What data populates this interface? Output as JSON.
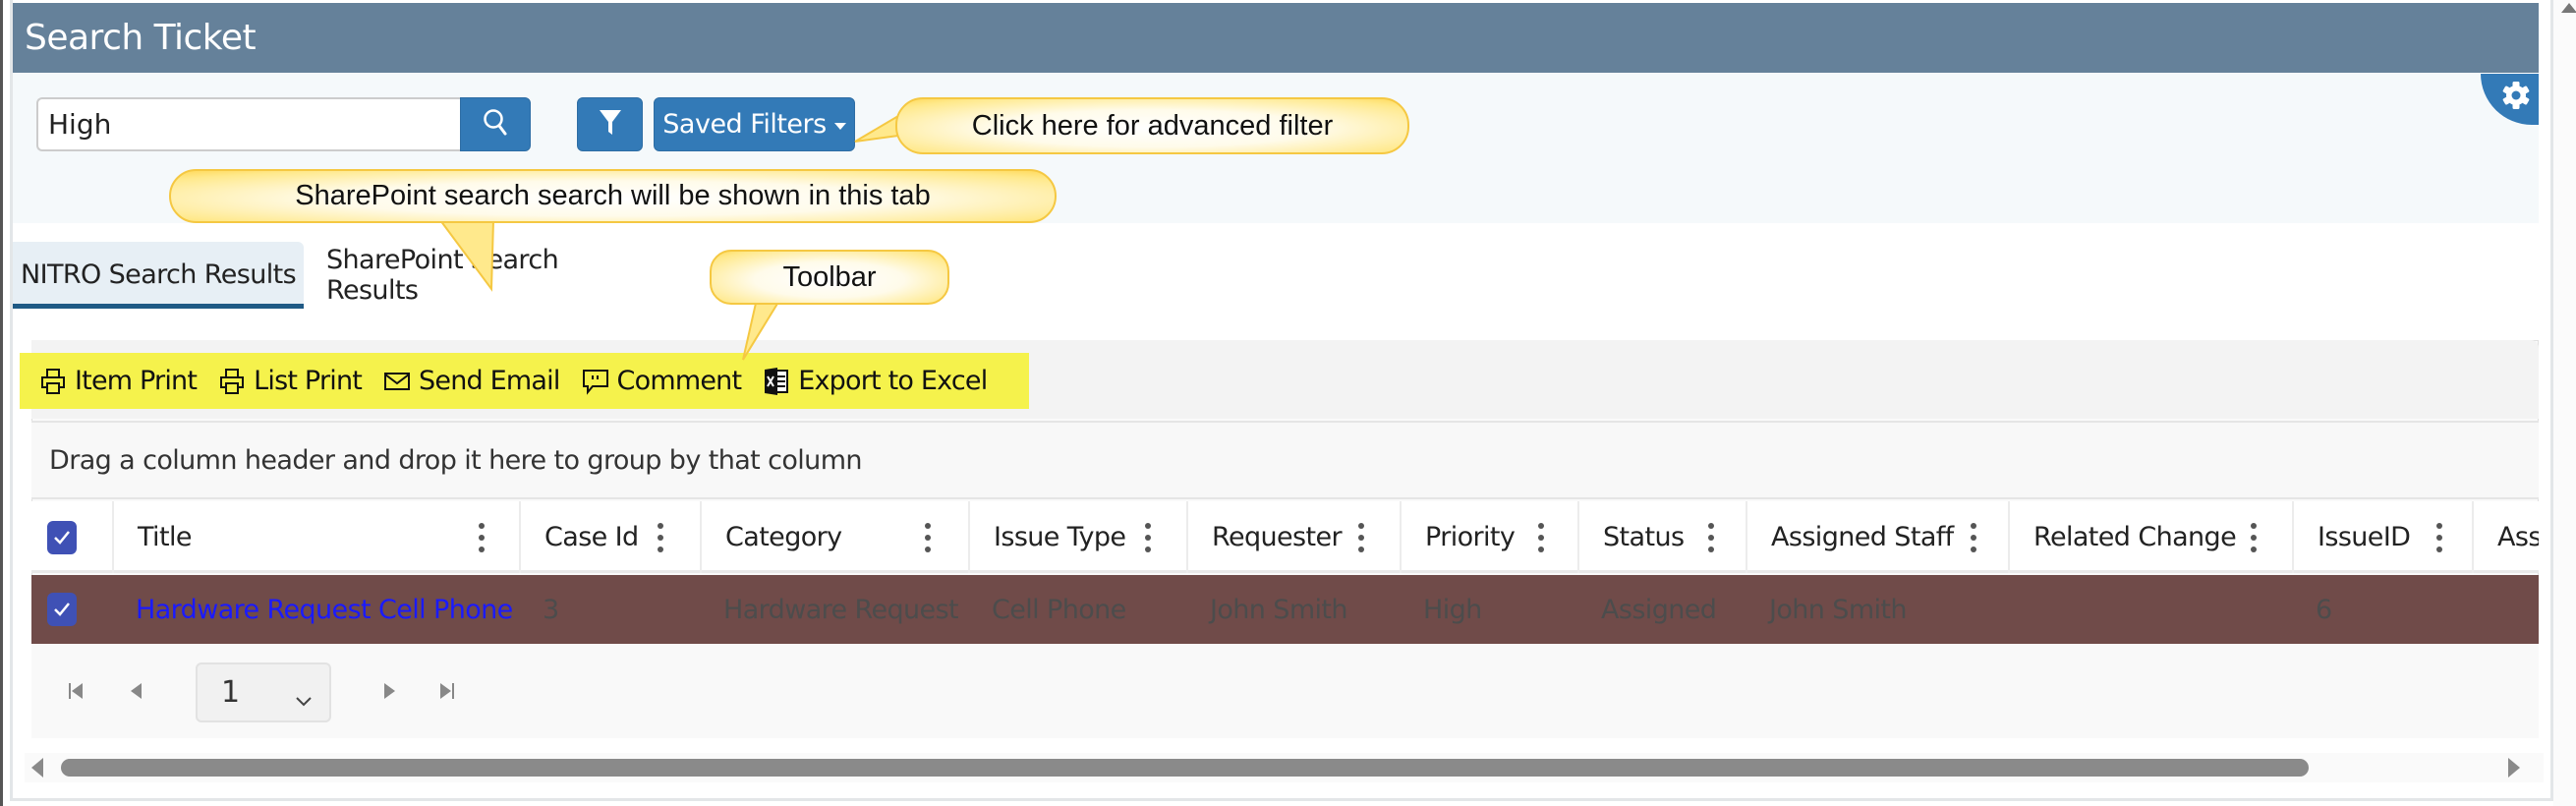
{
  "header": {
    "title": "Search Ticket"
  },
  "search": {
    "value": "High",
    "search_button": "search-icon",
    "filter_button": "filter-icon",
    "saved_filters_label": "Saved Filters",
    "settings_button": "gear-icon"
  },
  "callouts": {
    "advanced_filter": "Click here for advanced filter",
    "sharepoint_tab": "SharePoint search search will be shown in this tab",
    "toolbar": "Toolbar"
  },
  "tabs": [
    {
      "label": "NITRO Search Results",
      "active": true
    },
    {
      "label": "SharePoint Search Results",
      "active": false
    }
  ],
  "toolbar": {
    "items": [
      {
        "label": "Item Print",
        "icon": "printer-icon"
      },
      {
        "label": "List Print",
        "icon": "printer-icon"
      },
      {
        "label": "Send Email",
        "icon": "envelope-icon"
      },
      {
        "label": "Comment",
        "icon": "comment-icon"
      },
      {
        "label": "Export to Excel",
        "icon": "excel-icon"
      }
    ]
  },
  "grid": {
    "group_panel_text": "Drag a column header and drop it here to group by that column",
    "columns": [
      "Title",
      "Case Id",
      "Category",
      "Issue Type",
      "Requester",
      "Priority",
      "Status",
      "Assigned Staff",
      "Related Change",
      "IssueID",
      "Ass"
    ],
    "rows": [
      {
        "selected": true,
        "cells": [
          "Hardware Request Cell Phone",
          "3",
          "Hardware Request",
          "Cell Phone",
          "John Smith",
          "High",
          "Assigned",
          "John Smith",
          "",
          "6",
          ""
        ]
      }
    ],
    "colors": {
      "selected_row": "#704b49",
      "link": "#1a1aff",
      "checkbox": "#3f51b5"
    }
  },
  "pager": {
    "current_page": "1"
  },
  "colors": {
    "header": "#65819a",
    "primary_button": "#337ab7",
    "toolbar_highlight": "#f5f24c"
  }
}
